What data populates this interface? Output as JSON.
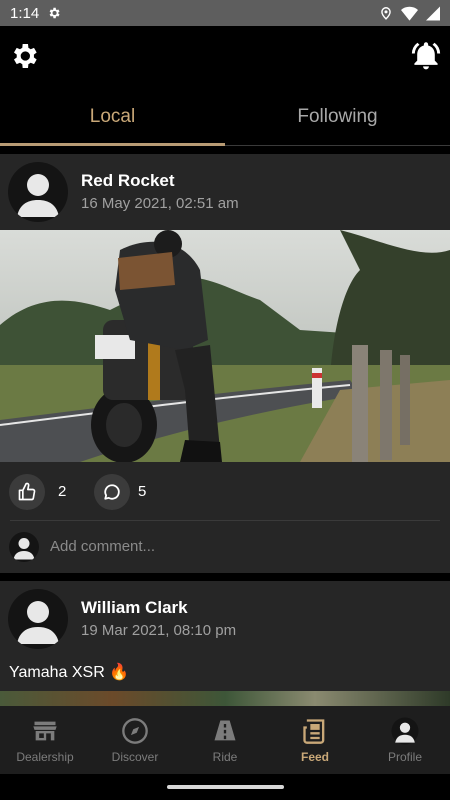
{
  "status_bar": {
    "time": "1:14"
  },
  "tabs": [
    {
      "label": "Local",
      "active": true
    },
    {
      "label": "Following",
      "active": false
    }
  ],
  "posts": [
    {
      "author": "Red Rocket",
      "date": "16 May 2021, 02:51 am",
      "likes": "2",
      "comments": "5",
      "comment_placeholder": "Add comment..."
    },
    {
      "author": "William Clark",
      "date": "19 Mar 2021, 08:10 pm",
      "caption": "Yamaha XSR 🔥"
    }
  ],
  "bottom_nav": [
    {
      "label": "Dealership",
      "icon": "store-icon",
      "active": false
    },
    {
      "label": "Discover",
      "icon": "compass-icon",
      "active": false
    },
    {
      "label": "Ride",
      "icon": "road-icon",
      "active": false
    },
    {
      "label": "Feed",
      "icon": "newspaper-icon",
      "active": true
    },
    {
      "label": "Profile",
      "icon": "profile-icon",
      "active": false
    }
  ],
  "colors": {
    "accent": "#c9a878",
    "card": "#262626",
    "background": "#000000",
    "nav": "#1e1e1e"
  }
}
